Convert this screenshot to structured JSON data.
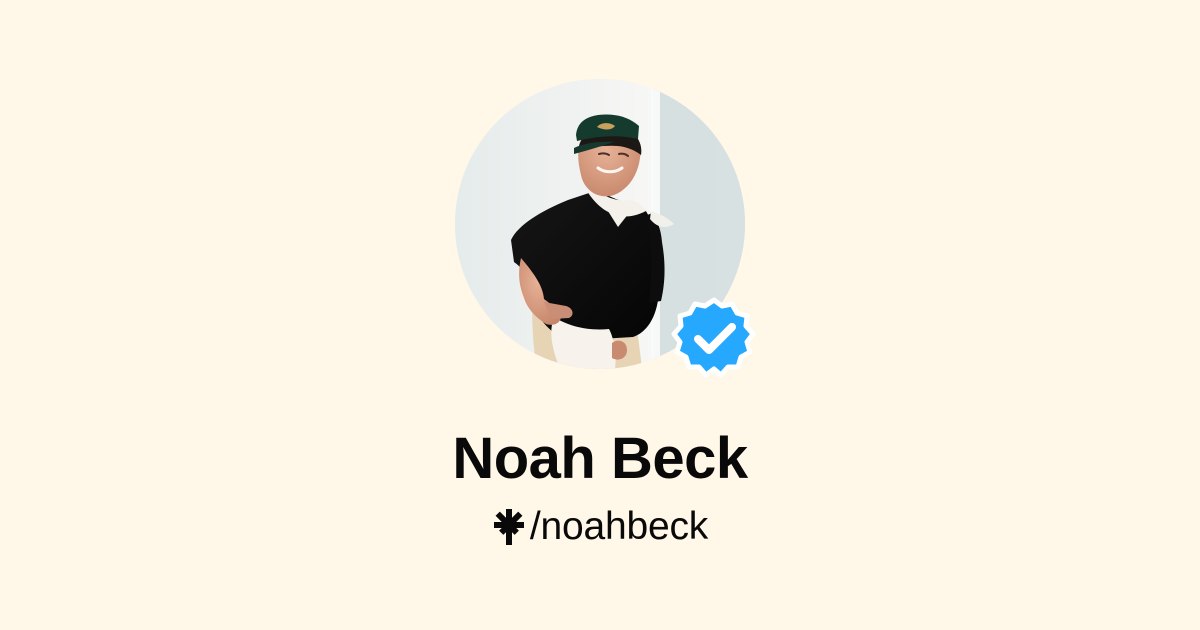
{
  "profile": {
    "name": "Noah Beck",
    "handle": "/noahbeck",
    "verified": true
  },
  "icons": {
    "brand": "linktree-asterisk-icon",
    "verification": "verified-badge-icon"
  },
  "colors": {
    "background": "#fff7e8",
    "text": "#090909",
    "verified_badge": "#27a8ff",
    "verified_check": "#ffffff"
  }
}
